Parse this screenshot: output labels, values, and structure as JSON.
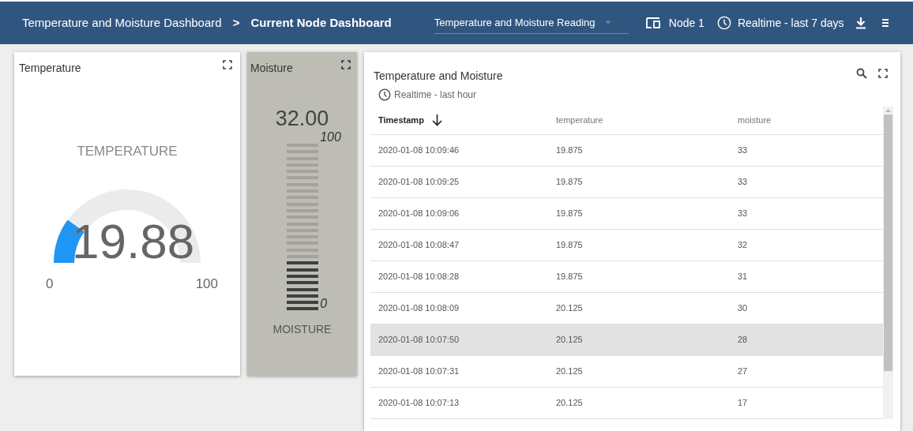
{
  "header": {
    "breadcrumb": [
      {
        "label": "Temperature and Moisture Dashboard",
        "current": false
      },
      {
        "label": "Current Node Dashboard",
        "current": true
      }
    ],
    "separator": ">",
    "state_select": "Temperature and Moisture Reading",
    "entity": "Node 1",
    "timewindow": "Realtime - last 7 days"
  },
  "temperature_card": {
    "title": "Temperature",
    "gauge_title": "TEMPERATURE",
    "value": "19.88",
    "min": "0",
    "max": "100"
  },
  "moisture_card": {
    "title": "Moisture",
    "value": "32.00",
    "level": 0.32,
    "max": "100",
    "min": "0",
    "label": "MOISTURE"
  },
  "table_card": {
    "title": "Temperature and Moisture",
    "timewindow": "Realtime - last hour",
    "columns": [
      {
        "label": "Timestamp",
        "sorted": true
      },
      {
        "label": "temperature",
        "sorted": false
      },
      {
        "label": "moisture",
        "sorted": false
      }
    ],
    "rows": [
      {
        "cells": [
          "2020-01-08 10:09:46",
          "19.875",
          "33"
        ],
        "selected": false
      },
      {
        "cells": [
          "2020-01-08 10:09:25",
          "19.875",
          "33"
        ],
        "selected": false
      },
      {
        "cells": [
          "2020-01-08 10:09:06",
          "19.875",
          "33"
        ],
        "selected": false
      },
      {
        "cells": [
          "2020-01-08 10:08:47",
          "19.875",
          "32"
        ],
        "selected": false
      },
      {
        "cells": [
          "2020-01-08 10:08:28",
          "19.875",
          "31"
        ],
        "selected": false
      },
      {
        "cells": [
          "2020-01-08 10:08:09",
          "20.125",
          "30"
        ],
        "selected": false
      },
      {
        "cells": [
          "2020-01-08 10:07:50",
          "20.125",
          "28"
        ],
        "selected": true
      },
      {
        "cells": [
          "2020-01-08 10:07:31",
          "20.125",
          "27"
        ],
        "selected": false
      },
      {
        "cells": [
          "2020-01-08 10:07:13",
          "20.125",
          "17"
        ],
        "selected": false
      }
    ]
  }
}
